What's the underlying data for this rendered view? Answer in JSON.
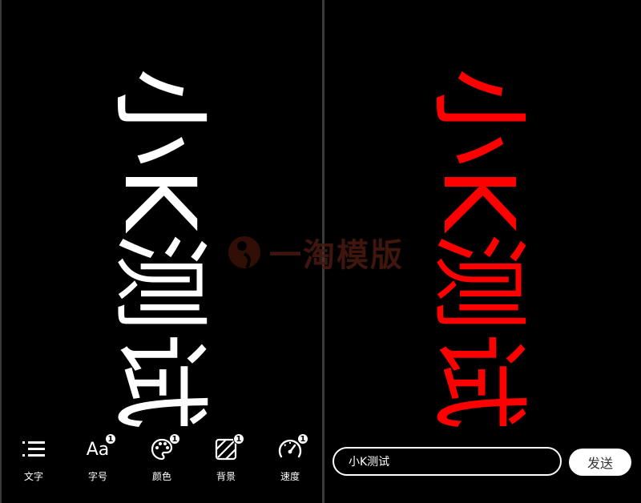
{
  "preview_left": {
    "marquee_text": "小K测试",
    "text_color": "#ffffff"
  },
  "toolbar": {
    "items": [
      {
        "label": "文字",
        "icon": "text-lines-icon",
        "badge": ""
      },
      {
        "label": "字号",
        "icon": "font-size-icon",
        "glyph": "Aa",
        "badge": "1"
      },
      {
        "label": "颜色",
        "icon": "palette-icon",
        "badge": "1"
      },
      {
        "label": "背景",
        "icon": "background-pattern-icon",
        "badge": "1"
      },
      {
        "label": "速度",
        "icon": "speedometer-icon",
        "badge": "1"
      }
    ]
  },
  "preview_right": {
    "marquee_text": "小K测试",
    "text_color": "#ff0000"
  },
  "send_bar": {
    "input_value": "小K测试",
    "send_label": "发送"
  },
  "watermark": {
    "text": "一淘模版"
  }
}
